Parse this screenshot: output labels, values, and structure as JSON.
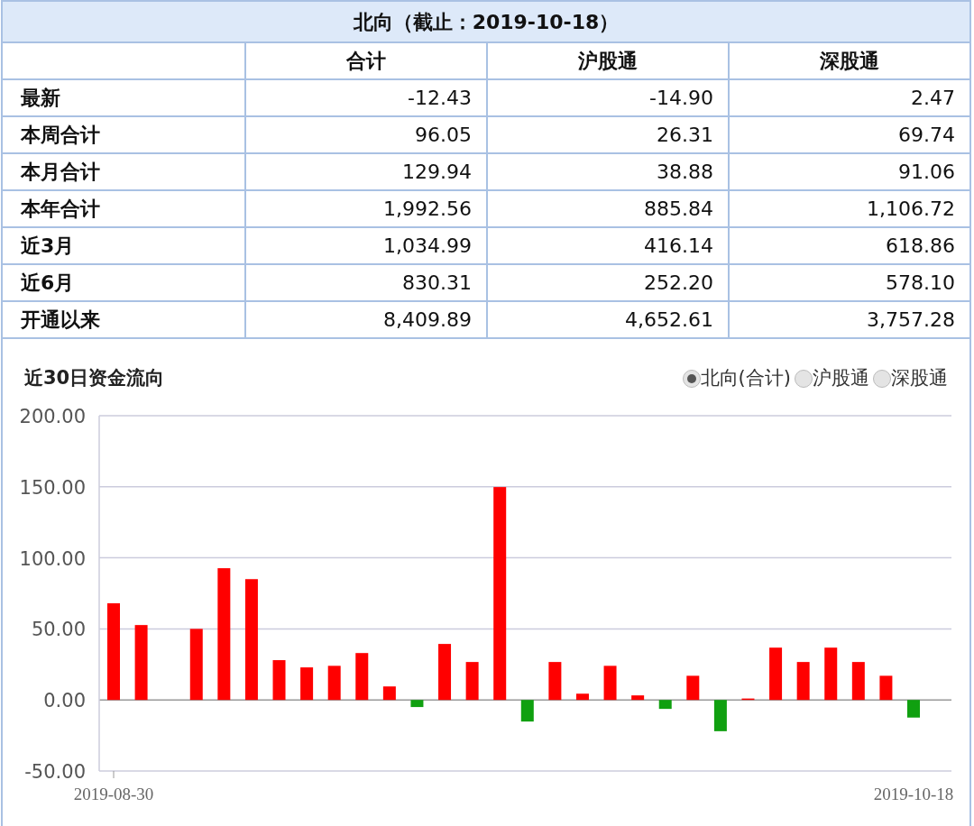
{
  "table": {
    "title": "北向（截止：2019-10-18）",
    "columns": [
      "合计",
      "沪股通",
      "深股通"
    ],
    "rows": [
      {
        "label": "最新",
        "values": [
          "-12.43",
          "-14.90",
          "2.47"
        ]
      },
      {
        "label": "本周合计",
        "values": [
          "96.05",
          "26.31",
          "69.74"
        ]
      },
      {
        "label": "本月合计",
        "values": [
          "129.94",
          "38.88",
          "91.06"
        ]
      },
      {
        "label": "本年合计",
        "values": [
          "1,992.56",
          "885.84",
          "1,106.72"
        ]
      },
      {
        "label": "近3月",
        "values": [
          "1,034.99",
          "416.14",
          "618.86"
        ]
      },
      {
        "label": "近6月",
        "values": [
          "830.31",
          "252.20",
          "578.10"
        ]
      },
      {
        "label": "开通以来",
        "values": [
          "8,409.89",
          "4,652.61",
          "3,757.28"
        ]
      }
    ]
  },
  "chart_panel": {
    "title": "近30日资金流向",
    "options": [
      {
        "label": "北向(合计)",
        "selected": true
      },
      {
        "label": "沪股通",
        "selected": false
      },
      {
        "label": "深股通",
        "selected": false
      }
    ],
    "chart_data": {
      "type": "bar",
      "ylim": [
        -50,
        200
      ],
      "grid": true,
      "categories": [
        "2019-08-30",
        null,
        null,
        null,
        null,
        null,
        null,
        null,
        null,
        null,
        null,
        null,
        null,
        null,
        null,
        null,
        null,
        null,
        null,
        null,
        null,
        null,
        null,
        null,
        null,
        null,
        null,
        null,
        null,
        "2019-10-18"
      ],
      "yticks": [
        {
          "value": 200,
          "label": "200.00"
        },
        {
          "value": 150,
          "label": "150.00"
        },
        {
          "value": 100,
          "label": "100.00"
        },
        {
          "value": 50,
          "label": "50.00"
        },
        {
          "value": 0,
          "label": "0.00"
        },
        {
          "value": -50,
          "label": "-50.00"
        }
      ],
      "series": [
        {
          "color": "#ff0000",
          "values": [
            68,
            52.7,
            null,
            50,
            92.7,
            85,
            28,
            22.9,
            24,
            33,
            9.5,
            null,
            39.4,
            26.7,
            149.8,
            null,
            26.7,
            4.4,
            24,
            3.2,
            null,
            17,
            null,
            1,
            36.8,
            26.7,
            36.8,
            26.7,
            17,
            null
          ]
        },
        {
          "color": "#10a010",
          "values": [
            null,
            null,
            null,
            null,
            null,
            null,
            null,
            null,
            null,
            null,
            null,
            -5,
            null,
            null,
            null,
            -15.2,
            null,
            null,
            null,
            null,
            -6.3,
            null,
            -22,
            null,
            null,
            null,
            null,
            null,
            null,
            -12.4
          ]
        }
      ]
    }
  }
}
